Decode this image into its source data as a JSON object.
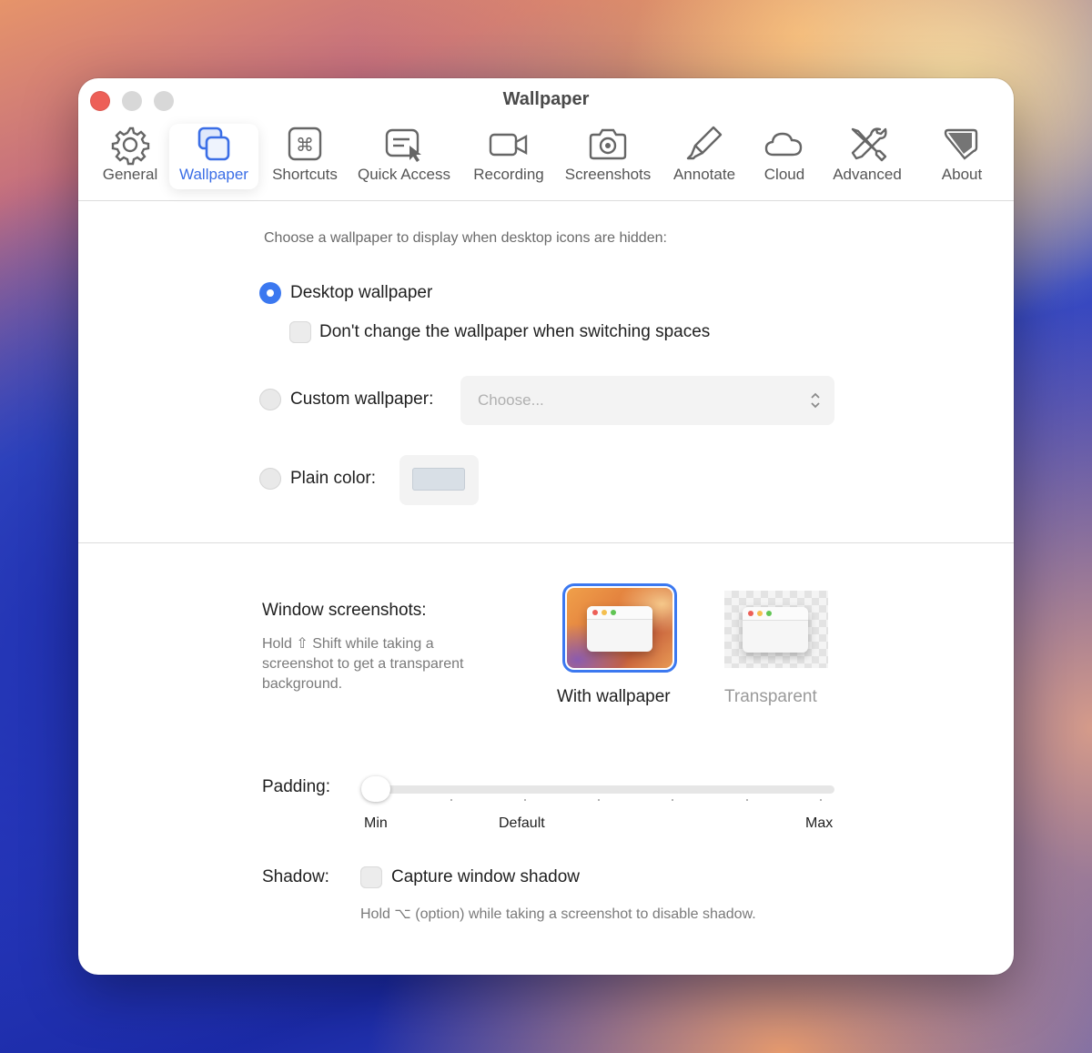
{
  "window": {
    "title": "Wallpaper"
  },
  "toolbar": {
    "items": [
      {
        "label": "General",
        "icon": "gear-icon"
      },
      {
        "label": "Wallpaper",
        "icon": "wallpaper-icon",
        "selected": true
      },
      {
        "label": "Shortcuts",
        "icon": "command-key-icon"
      },
      {
        "label": "Quick Access",
        "icon": "quick-access-icon"
      },
      {
        "label": "Recording",
        "icon": "video-camera-icon"
      },
      {
        "label": "Screenshots",
        "icon": "camera-icon"
      },
      {
        "label": "Annotate",
        "icon": "highlighter-icon"
      },
      {
        "label": "Cloud",
        "icon": "cloud-icon"
      },
      {
        "label": "Advanced",
        "icon": "tools-icon"
      },
      {
        "label": "About",
        "icon": "about-icon"
      }
    ],
    "accent": "#3b6ee6"
  },
  "wallpaper": {
    "intro": "Choose a wallpaper to display when desktop icons are hidden:",
    "desktop_label": "Desktop wallpaper",
    "desktop_selected": true,
    "dont_change_label": "Don't change the wallpaper when switching spaces",
    "dont_change_checked": false,
    "custom_label": "Custom wallpaper:",
    "custom_placeholder": "Choose...",
    "plain_label": "Plain color:",
    "plain_color": "#d8dfe6"
  },
  "window_screenshots": {
    "heading": "Window screenshots:",
    "hint": [
      "Hold ⇧ Shift while taking a",
      "screenshot to get a transparent",
      "background."
    ],
    "options": [
      {
        "label": "With wallpaper",
        "selected": true
      },
      {
        "label": "Transparent",
        "selected": false
      }
    ]
  },
  "padding": {
    "label": "Padding:",
    "min_label": "Min",
    "default_label": "Default",
    "max_label": "Max",
    "value": 0
  },
  "shadow": {
    "label": "Shadow:",
    "checkbox_label": "Capture window shadow",
    "checked": false,
    "hint": "Hold ⌥ (option) while taking a screenshot to disable shadow."
  }
}
